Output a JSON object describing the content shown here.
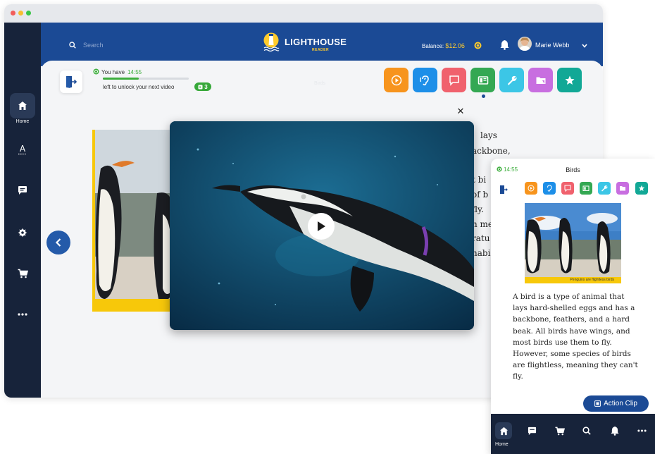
{
  "app": {
    "logo_title": "LIGHTHOUSE",
    "logo_subtitle": "READER",
    "search_placeholder": "Search",
    "balance_label": "Balance:",
    "balance_value": "$12.06",
    "user_name": "Marie Webb"
  },
  "sidebar": {
    "items": [
      {
        "icon": "home-icon",
        "label": "Home",
        "active": true
      },
      {
        "icon": "font-icon"
      },
      {
        "icon": "chat-icon"
      },
      {
        "icon": "gear-icon"
      },
      {
        "icon": "cart-icon"
      },
      {
        "icon": "more-icon"
      }
    ]
  },
  "timer": {
    "prefix": "You have",
    "time": "14:55",
    "progress": 0.42,
    "unlock_text": "left to unlock your next video",
    "badge_count": "3"
  },
  "page": {
    "faint_title": "Birds"
  },
  "toolbar": {
    "tools": [
      {
        "icon": "play-circle-icon",
        "color": "#f7941d"
      },
      {
        "icon": "ear-icon",
        "color": "#1d8fe8"
      },
      {
        "icon": "comment-icon",
        "color": "#f0616d"
      },
      {
        "icon": "book-icon",
        "color": "#34a853"
      },
      {
        "icon": "wrench-icon",
        "color": "#3cc6e6"
      },
      {
        "icon": "folder-icon",
        "color": "#c86ee0"
      },
      {
        "icon": "star-icon",
        "color": "#12a896"
      }
    ]
  },
  "story_fragments": [
    "lays",
    "ackbone,",
    "t bi",
    "of b",
    "fly.",
    "n me",
    "ratu",
    "nabi"
  ],
  "tablet": {
    "time": "14:55",
    "title": "Birds",
    "photo_caption": "Penguins are flightless birds",
    "story": "A bird is a type of animal that lays hard-shelled eggs and has a backbone, feathers, and a hard beak. All birds have wings, and most birds use them to fly. However, some species of birds are flightless, meaning they can't fly.",
    "action_clip": "Action Clip",
    "nav": [
      {
        "icon": "home-icon",
        "label": "Home",
        "active": true
      },
      {
        "icon": "chat-icon"
      },
      {
        "icon": "cart-icon"
      },
      {
        "icon": "search-icon"
      },
      {
        "icon": "bell-icon"
      },
      {
        "icon": "more-icon"
      }
    ]
  },
  "colors": {
    "primary": "#1b4a95",
    "sidebar": "#17233a",
    "accent_yellow": "#ffcb2d",
    "success": "#3dae3d"
  }
}
